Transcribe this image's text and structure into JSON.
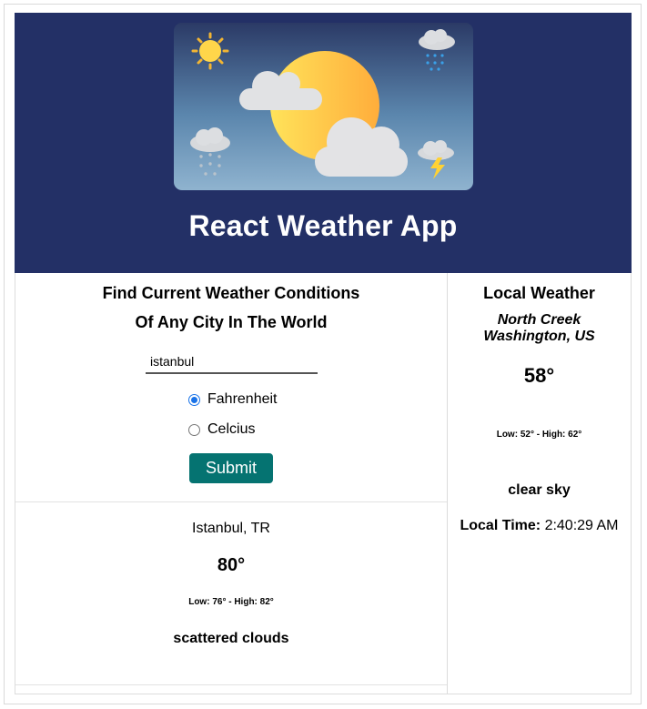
{
  "header": {
    "title": "React Weather App",
    "hero_image": "weather-illustration"
  },
  "search": {
    "heading_line1": "Find Current Weather Conditions",
    "heading_line2": "Of Any City In The World",
    "city_value": "istanbul",
    "units": [
      {
        "label": "Fahrenheit",
        "selected": true
      },
      {
        "label": "Celcius",
        "selected": false
      }
    ],
    "submit_label": "Submit"
  },
  "result": {
    "location": "Istanbul, TR",
    "temperature": "80°",
    "low_high": "Low: 76° - High: 82°",
    "description": "scattered clouds"
  },
  "local": {
    "heading": "Local Weather",
    "city": "North Creek",
    "region": "Washington, US",
    "temperature": "58°",
    "low_high": "Low: 52° - High: 62°",
    "description": "clear sky",
    "time_label": "Local Time:",
    "time_value": "2:40:29 AM"
  },
  "colors": {
    "header_bg": "#233066",
    "submit_bg": "#057371",
    "radio_accent": "#1a73e8"
  }
}
